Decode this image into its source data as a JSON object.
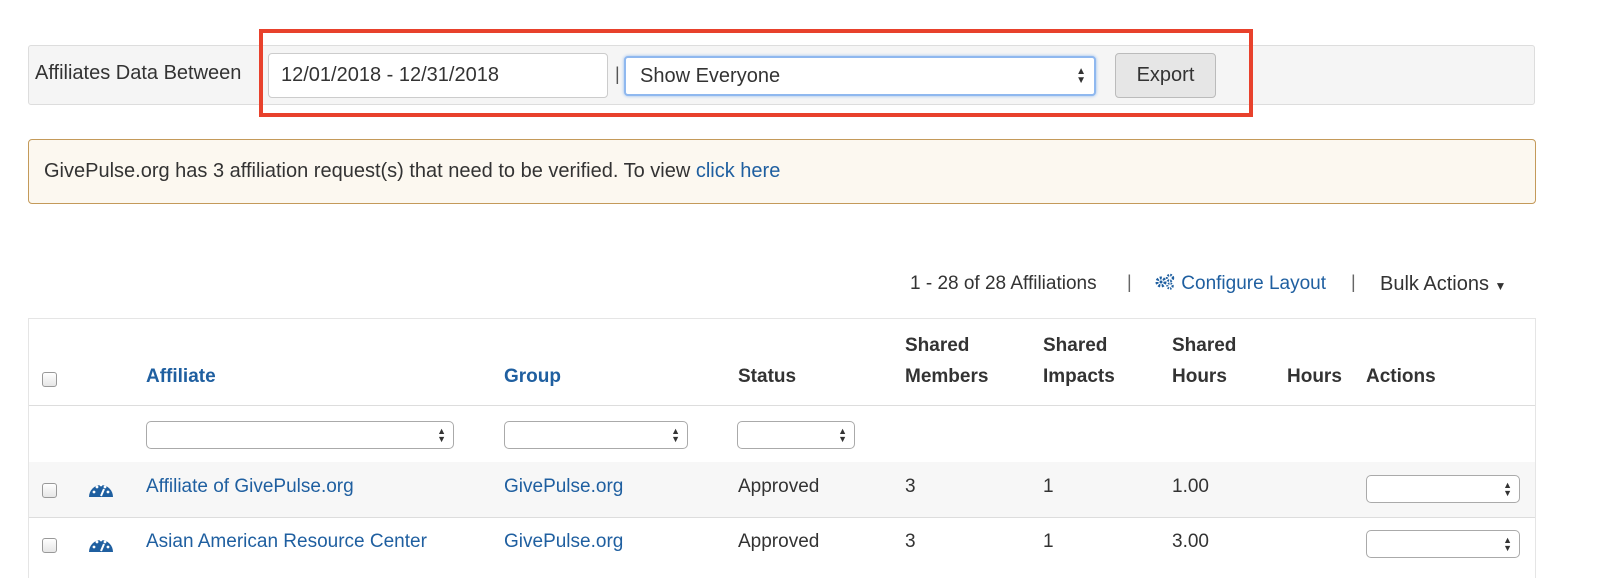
{
  "filter": {
    "label": "Affiliates Data Between",
    "date_range": "12/01/2018 - 12/31/2018",
    "separator": "|",
    "show_select": "Show Everyone",
    "export_label": "Export"
  },
  "alert": {
    "text": "GivePulse.org has 3 affiliation request(s) that need to be verified. To view ",
    "link": "click here"
  },
  "toolbar": {
    "count": "1 - 28 of 28 Affiliations",
    "configure_label": "Configure Layout",
    "bulk_label": "Bulk Actions",
    "pipe": "|"
  },
  "table": {
    "headers": {
      "affiliate": "Affiliate",
      "group": "Group",
      "status": "Status",
      "shared_members_1": "Shared",
      "shared_members_2": "Members",
      "shared_impacts_1": "Shared",
      "shared_impacts_2": "Impacts",
      "shared_hours_1": "Shared",
      "shared_hours_2": "Hours",
      "hours": "Hours",
      "actions": "Actions"
    },
    "rows": [
      {
        "affiliate": "Affiliate of GivePulse.org",
        "group": "GivePulse.org",
        "status": "Approved",
        "shared_members": "3",
        "shared_impacts": "1",
        "shared_hours": "1.00"
      },
      {
        "affiliate": "Asian American Resource Center",
        "group": "GivePulse.org",
        "status": "Approved",
        "shared_members": "3",
        "shared_impacts": "1",
        "shared_hours": "3.00"
      }
    ]
  },
  "colors": {
    "link": "#1f5fa0",
    "highlight": "#e8412c",
    "focus": "#8fb8ef"
  }
}
